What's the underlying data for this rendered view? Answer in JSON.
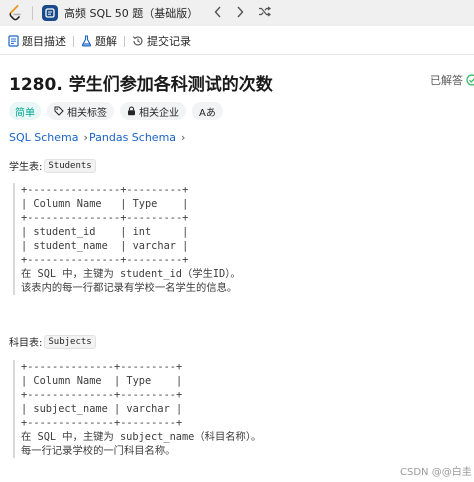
{
  "toolbar": {
    "problem_list_label": "高频 SQL 50 题（基础版）",
    "prev_symbol": "‹",
    "next_symbol": "›",
    "shuffle_symbol": "⤨"
  },
  "tabs": [
    {
      "label": "题目描述",
      "icon": "description-icon"
    },
    {
      "label": "题解",
      "icon": "flask-icon"
    },
    {
      "label": "提交记录",
      "icon": "history-icon"
    }
  ],
  "problem": {
    "title": "1280. 学生们参加各科测试的次数",
    "status": "已解答",
    "difficulty": "简单",
    "tags": [
      "相关标签",
      "相关企业"
    ],
    "font_toggle": "Aあ"
  },
  "schemas": {
    "sql": "SQL Schema",
    "pandas": "Pandas Schema",
    "chevron": "›"
  },
  "students_table": {
    "label": "学生表:",
    "name": "Students",
    "lines": [
      "+---------------+---------+",
      "| Column Name   | Type    |",
      "+---------------+---------+",
      "| student_id    | int     |",
      "| student_name  | varchar |",
      "+---------------+---------+",
      "在 SQL 中，主键为 student_id（学生ID）。",
      "该表内的每一行都记录有学校一名学生的信息。"
    ]
  },
  "subjects_table": {
    "label": "科目表:",
    "name": "Subjects",
    "lines": [
      "+--------------+---------+",
      "| Column Name  | Type    |",
      "+--------------+---------+",
      "| subject_name | varchar |",
      "+--------------+---------+",
      "在 SQL 中，主键为 subject_name（科目名称）。",
      "每一行记录学校的一门科目名称。"
    ]
  },
  "watermark": "CSDN @@白圭",
  "colors": {
    "brand_orange": "#ffa116",
    "link_blue": "#1a63c6",
    "easy_green": "#00a88f",
    "list_icon_bg": "#1a4a8a"
  }
}
